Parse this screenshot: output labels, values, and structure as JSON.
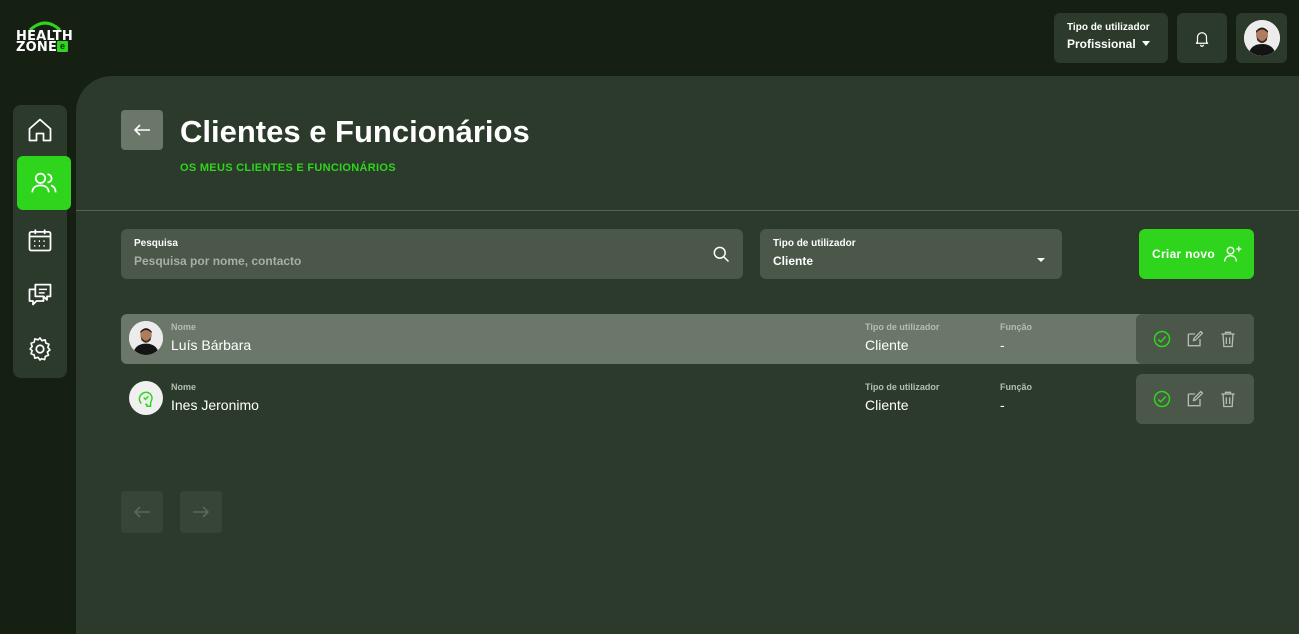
{
  "brand": {
    "line1": "HEALTH",
    "line2": "ZONE",
    "badge": "e",
    "accent": "#2fd51c"
  },
  "header": {
    "user_type_label": "Tipo de utilizador",
    "user_type_value": "Profissional",
    "bell_icon": "bell-icon",
    "avatar_icon": "user-avatar"
  },
  "sidebar": {
    "items": [
      {
        "icon": "home-icon",
        "active": false
      },
      {
        "icon": "users-icon",
        "active": true
      },
      {
        "icon": "calendar-icon",
        "active": false
      },
      {
        "icon": "chat-icon",
        "active": false
      },
      {
        "icon": "gear-icon",
        "active": false
      }
    ]
  },
  "page": {
    "title": "Clientes e Funcionários",
    "subtitle": "OS MEUS CLIENTES E FUNCIONÁRIOS"
  },
  "search": {
    "label": "Pesquisa",
    "placeholder": "Pesquisa por nome, contacto"
  },
  "type_filter": {
    "label": "Tipo de utilizador",
    "value": "Cliente"
  },
  "create_button": {
    "label": "Criar novo"
  },
  "table": {
    "name_label": "Nome",
    "type_label": "Tipo de utilizador",
    "function_label": "Função",
    "rows": [
      {
        "name": "Luís Bárbara",
        "type": "Cliente",
        "function": "-"
      },
      {
        "name": "Ines Jeronimo",
        "type": "Cliente",
        "function": "-"
      }
    ]
  },
  "colors": {
    "background": "#152013",
    "panel": "#2c3a2b",
    "field": "#4a5749",
    "highlight_row": "#6a7769"
  }
}
